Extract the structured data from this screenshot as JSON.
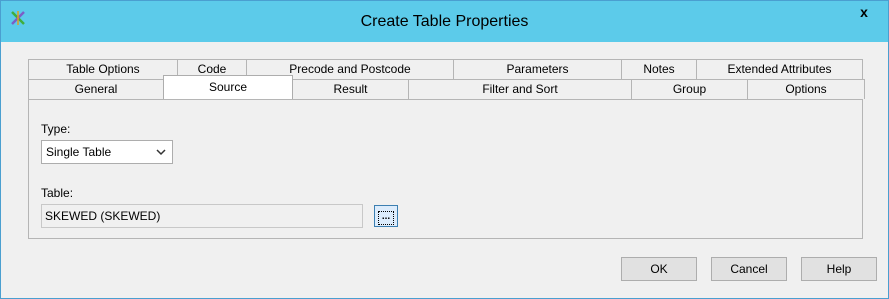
{
  "window": {
    "title": "Create Table Properties",
    "close_label": "x"
  },
  "tabs_back": [
    "Table Options",
    "Code",
    "Precode and Postcode",
    "Parameters",
    "Notes",
    "Extended Attributes"
  ],
  "tabs_front": [
    "General",
    "Source",
    "Result",
    "Filter and Sort",
    "Group",
    "Options"
  ],
  "selected_tab": "Source",
  "source": {
    "type_label": "Type:",
    "type_value": "Single Table",
    "table_label": "Table:",
    "table_value": "SKEWED (SKEWED)",
    "browse_label": "..."
  },
  "buttons": {
    "ok": "OK",
    "cancel": "Cancel",
    "help": "Help"
  },
  "colors": {
    "titlebar": "#5ccbea",
    "browse_bg": "#dcecfc",
    "browse_border": "#3c7fb1"
  }
}
